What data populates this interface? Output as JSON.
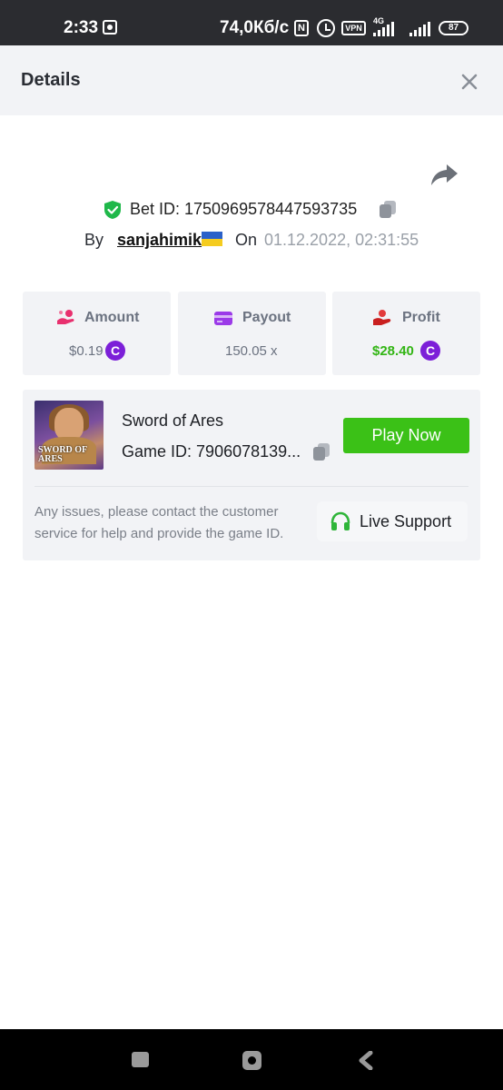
{
  "status_bar": {
    "time": "2:33",
    "network_speed": "74,0Кб/с",
    "vpn_label": "VPN",
    "network_type": "4G",
    "battery": "87"
  },
  "header": {
    "title": "Details",
    "close_icon": "close-icon"
  },
  "share_icon": "share-icon",
  "bet": {
    "id_label": "Bet ID:",
    "id_value": "1750969578447593735",
    "by_label": "By",
    "username": "sanjahimik",
    "flag": "ukraine-flag",
    "on_label": "On",
    "date": "01.12.2022, 02:31:55"
  },
  "stats": {
    "amount": {
      "label": "Amount",
      "value": "$0.19",
      "icon": "coins-hand-icon"
    },
    "payout": {
      "label": "Payout",
      "value": "150.05 x",
      "icon": "card-icon"
    },
    "profit": {
      "label": "Profit",
      "value": "$28.40",
      "icon": "money-hand-icon"
    },
    "currency_symbol": "C"
  },
  "game": {
    "thumb_text": "SWORD OF ARES",
    "name": "Sword of Ares",
    "id_label": "Game ID:",
    "id_value": "7906078139...",
    "play_label": "Play Now",
    "help_text": "Any issues, please contact the customer service for help and provide the game ID.",
    "support_label": "Live Support"
  },
  "colors": {
    "accent_green": "#3bc117",
    "coin_purple": "#7c1fd8",
    "profit_green": "#32b514",
    "panel_bg": "#f2f3f6"
  }
}
